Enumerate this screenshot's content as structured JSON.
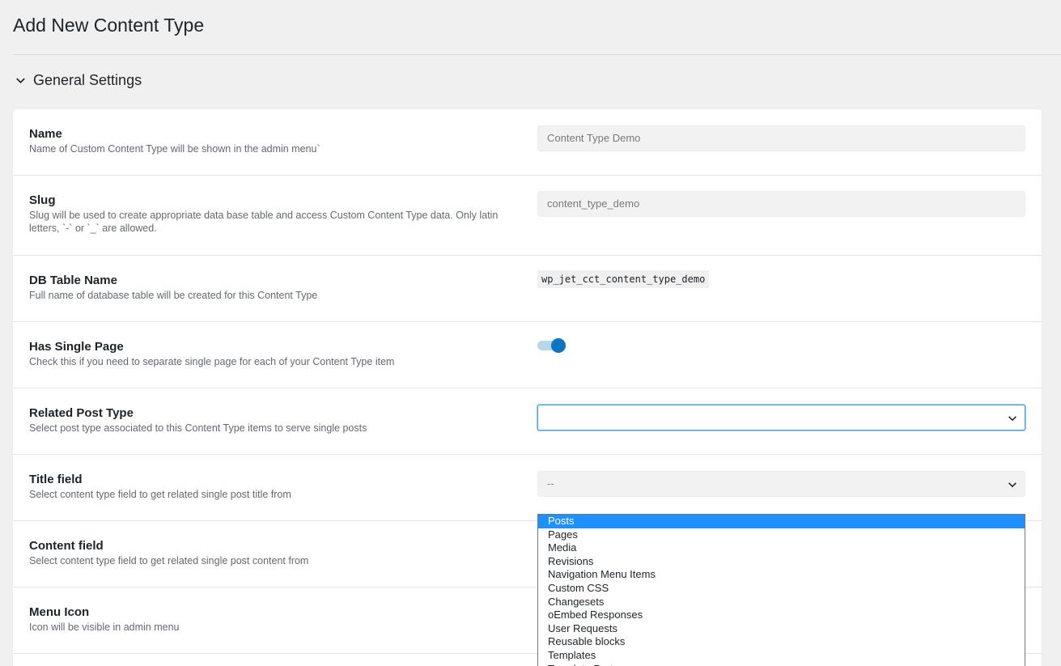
{
  "page": {
    "title": "Add New Content Type"
  },
  "section": {
    "title": "General Settings"
  },
  "fields": {
    "name": {
      "label": "Name",
      "desc": "Name of Custom Content Type will be shown in the admin menu`",
      "value": "Content Type Demo"
    },
    "slug": {
      "label": "Slug",
      "desc": "Slug will be used to create appropriate data base table and access Custom Content Type data. Only latin letters, `-` or `_` are allowed.",
      "value": "content_type_demo"
    },
    "db_table": {
      "label": "DB Table Name",
      "desc": "Full name of database table will be created for this Content Type",
      "value": "wp_jet_cct_content_type_demo"
    },
    "single_page": {
      "label": "Has Single Page",
      "desc": "Check this if you need to separate single page for each of your Content Type item",
      "enabled": true
    },
    "related_post_type": {
      "label": "Related Post Type",
      "desc": "Select post type associated to this Content Type items to serve single posts",
      "value": ""
    },
    "title_field": {
      "label": "Title field",
      "desc": "Select content type field to get related single post title from",
      "value": "--"
    },
    "content_field": {
      "label": "Content field",
      "desc": "Select content type field to get related single post content from"
    },
    "menu_icon": {
      "label": "Menu Icon",
      "desc": "Icon will be visible in admin menu"
    }
  },
  "dropdown": {
    "options": [
      "Posts",
      "Pages",
      "Media",
      "Revisions",
      "Navigation Menu Items",
      "Custom CSS",
      "Changesets",
      "oEmbed Responses",
      "User Requests",
      "Reusable blocks",
      "Templates",
      "Template Parts"
    ],
    "highlighted": "Posts"
  },
  "colors": {
    "accent": "#0a75c2",
    "highlight": "#1e90ff",
    "focus_border": "#4a9fd8"
  }
}
